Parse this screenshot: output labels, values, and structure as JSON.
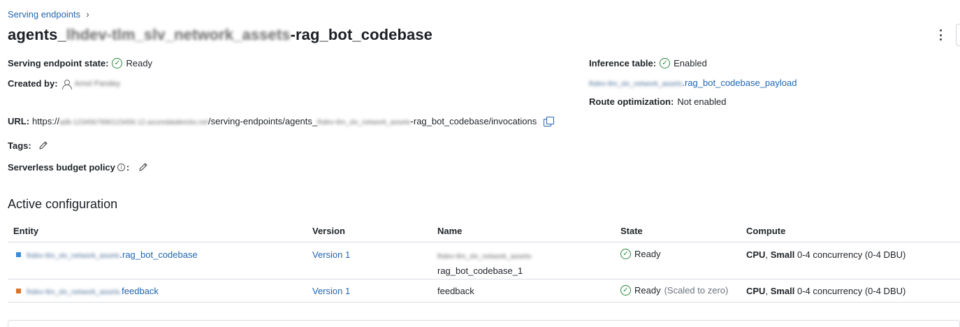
{
  "breadcrumb": {
    "label": "Serving endpoints",
    "separator": "›"
  },
  "title": {
    "prefix": "agents_",
    "redacted": "lhdev-tlm_slv_network_assets",
    "suffix": "-rag_bot_codebase"
  },
  "details": {
    "state_label": "Serving endpoint state:",
    "state_value": "Ready",
    "created_label": "Created by:",
    "created_value": "Amol Pandey",
    "inference_label": "Inference table:",
    "inference_value": "Enabled",
    "payload_redacted": "lhdev-tlm_slv_network_assets",
    "payload_suffix": ".rag_bot_codebase_payload",
    "route_label": "Route optimization:",
    "route_value": "Not enabled",
    "url_label": "URL:",
    "url_prefix": "https://",
    "url_redacted_host": "adb-1234567890123456.12.azuredatabricks.net",
    "url_mid": "/serving-endpoints/agents_",
    "url_redacted_name": "lhdev-tlm_slv_network_assets",
    "url_suffix": "-rag_bot_codebase/invocations",
    "tags_label": "Tags:",
    "budget_label": "Serverless budget policy",
    "budget_colon": ":"
  },
  "config": {
    "title": "Active configuration",
    "headers": {
      "entity": "Entity",
      "version": "Version",
      "name": "Name",
      "state": "State",
      "compute": "Compute"
    },
    "rows": [
      {
        "color": "#3b8ad9",
        "entity_redacted": "lhdev-tlm_slv_network_assets",
        "entity_suffix": ".rag_bot_codebase",
        "version": "Version 1",
        "name_redacted": "lhdev-tlm_slv_network_assets-",
        "name_line2": "rag_bot_codebase_1",
        "state": "Ready",
        "state_note": "",
        "compute_cpu": "CPU",
        "compute_size": "Small",
        "compute_rest": "0-4 concurrency (0-4 DBU)"
      },
      {
        "color": "#d9742b",
        "entity_redacted": "lhdev-tlm_slv_network_assets.",
        "entity_suffix": "feedback",
        "version": "Version 1",
        "name": "feedback",
        "state": "Ready",
        "state_note": "(Scaled to zero)",
        "compute_cpu": "CPU",
        "compute_size": "Small",
        "compute_rest": "0-4 concurrency (0-4 DBU)"
      }
    ]
  },
  "icons": [
    "chevron-right-icon",
    "kebab-menu-icon",
    "check-circle-icon",
    "user-icon",
    "copy-icon",
    "pencil-icon",
    "info-icon"
  ]
}
